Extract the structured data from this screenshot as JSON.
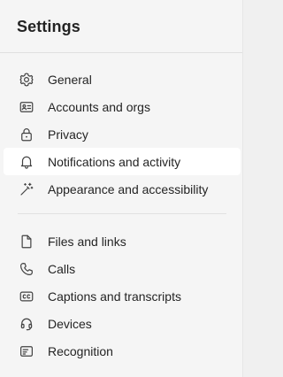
{
  "header": {
    "title": "Settings"
  },
  "menu": {
    "group1": [
      {
        "label": "General",
        "icon": "gear-icon"
      },
      {
        "label": "Accounts and orgs",
        "icon": "id-card-icon"
      },
      {
        "label": "Privacy",
        "icon": "lock-icon"
      },
      {
        "label": "Notifications and activity",
        "icon": "bell-icon",
        "active": true
      },
      {
        "label": "Appearance and accessibility",
        "icon": "magic-wand-icon"
      }
    ],
    "group2": [
      {
        "label": "Files and links",
        "icon": "document-icon"
      },
      {
        "label": "Calls",
        "icon": "phone-icon"
      },
      {
        "label": "Captions and transcripts",
        "icon": "closed-captions-icon"
      },
      {
        "label": "Devices",
        "icon": "headset-icon"
      },
      {
        "label": "Recognition",
        "icon": "recognition-icon"
      }
    ]
  }
}
